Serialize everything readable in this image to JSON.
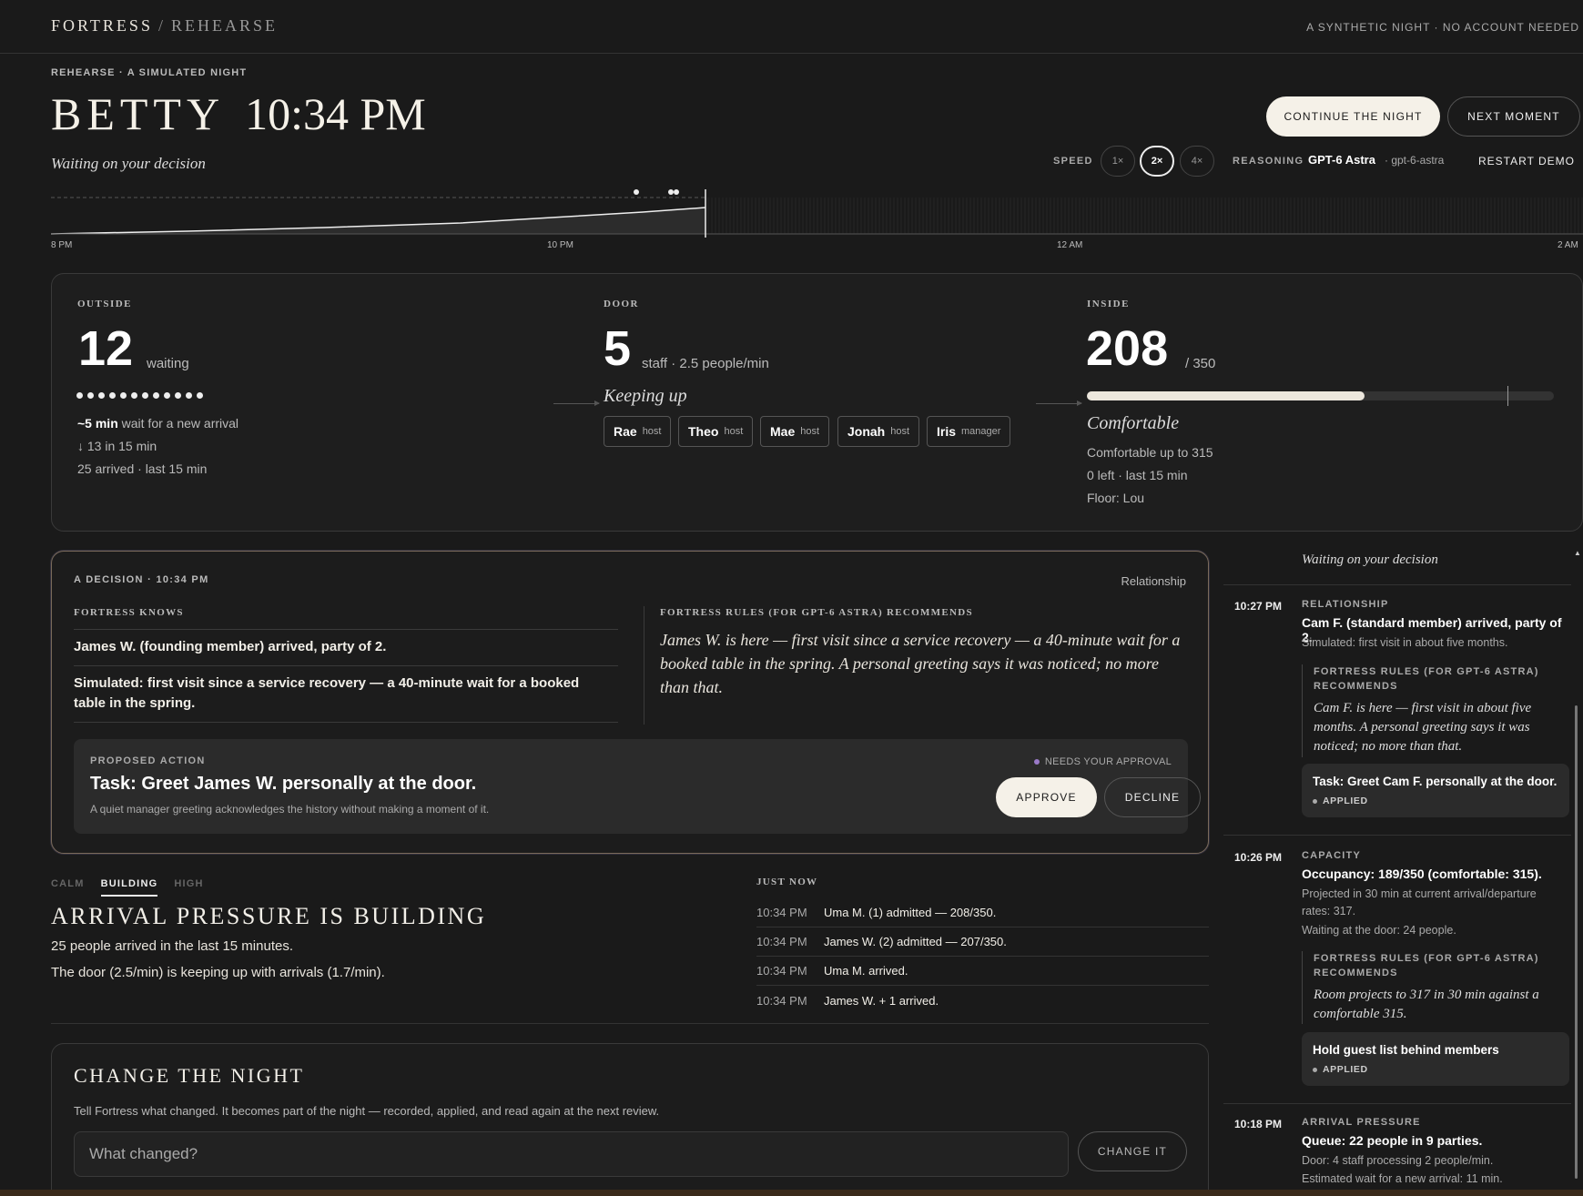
{
  "brand": {
    "name": "FORTRESS",
    "sep": "/",
    "section": "REHEARSE"
  },
  "top_right": "A SYNTHETIC NIGHT · NO ACCOUNT NEEDED",
  "eyebrow": "REHEARSE · A SIMULATED NIGHT",
  "hero": {
    "name": "BETTY",
    "time": "10:34 PM",
    "status": "Waiting on your decision"
  },
  "actions": {
    "continue": "CONTINUE THE NIGHT",
    "next": "NEXT MOMENT",
    "restart": "RESTART DEMO"
  },
  "speed": {
    "label": "SPEED",
    "options": [
      "1×",
      "2×",
      "4×"
    ],
    "selected": "2×"
  },
  "reasoning": {
    "label": "REASONING",
    "model_name": "GPT-6 Astra",
    "model_id": "· gpt-6-astra"
  },
  "timeline": {
    "ticks": [
      "8 PM",
      "10 PM",
      "12 AM",
      "2 AM"
    ],
    "progress": 0.425
  },
  "outside": {
    "label": "OUTSIDE",
    "count": "12",
    "unit": "waiting",
    "dot_count": 12,
    "wait_value": "~5 min",
    "wait_text": "wait for a new arrival",
    "trend": "↓ 13 in 15 min",
    "arrived": "25 arrived · last 15 min"
  },
  "door": {
    "label": "DOOR",
    "count": "5",
    "unit": "staff · 2.5 people/min",
    "status": "Keeping up",
    "staff": [
      {
        "name": "Rae",
        "role": "host"
      },
      {
        "name": "Theo",
        "role": "host"
      },
      {
        "name": "Mae",
        "role": "host"
      },
      {
        "name": "Jonah",
        "role": "host"
      },
      {
        "name": "Iris",
        "role": "manager"
      }
    ]
  },
  "inside": {
    "label": "INSIDE",
    "count": "208",
    "capacity": "/ 350",
    "fill_fraction": 0.594,
    "comfort_fraction": 0.9,
    "status": "Comfortable",
    "comfort_line": "Comfortable up to 315",
    "left_line": "0 left · last 15 min",
    "floor": "Floor: Lou"
  },
  "decision": {
    "eyebrow": "A DECISION · 10:34 PM",
    "tag": "Relationship",
    "knows_label": "FORTRESS KNOWS",
    "knows": [
      "James W. (founding member) arrived, party of 2.",
      "Simulated: first visit since a service recovery — a 40-minute wait for a booked table in the spring."
    ],
    "rec_label": "FORTRESS RULES (FOR GPT-6 ASTRA) RECOMMENDS",
    "rec_text": "James W. is here — first visit since a service recovery — a 40-minute wait for a booked table in the spring. A personal greeting says it was noticed; no more than that.",
    "proposal": {
      "label": "PROPOSED ACTION",
      "needs": "NEEDS YOUR APPROVAL",
      "title": "Task: Greet James W. personally at the door.",
      "desc": "A quiet manager greeting acknowledges the history without making a moment of it.",
      "approve": "APPROVE",
      "decline": "DECLINE"
    }
  },
  "pressure": {
    "tabs": [
      "CALM",
      "BUILDING",
      "HIGH"
    ],
    "active": "BUILDING",
    "heading": "ARRIVAL PRESSURE IS BUILDING",
    "lines": [
      "25 people arrived in the last 15 minutes.",
      "The door (2.5/min) is keeping up with arrivals (1.7/min)."
    ]
  },
  "just_now": {
    "label": "JUST NOW",
    "rows": [
      {
        "time": "10:34 PM",
        "text": "Uma M. (1) admitted — 208/350."
      },
      {
        "time": "10:34 PM",
        "text": "James W. (2) admitted — 207/350."
      },
      {
        "time": "10:34 PM",
        "text": "Uma M. arrived."
      },
      {
        "time": "10:34 PM",
        "text": "James W. + 1 arrived."
      }
    ]
  },
  "change": {
    "title": "CHANGE THE NIGHT",
    "desc": "Tell Fortress what changed. It becomes part of the night — recorded, applied, and read again at the next review.",
    "placeholder": "What changed?",
    "button": "CHANGE IT"
  },
  "log": {
    "head": "Waiting on your decision",
    "entries": [
      {
        "time": "10:27 PM",
        "category": "RELATIONSHIP",
        "title": "Cam F. (standard member) arrived, party of 2.",
        "subs": [
          "Simulated: first visit in about five months."
        ],
        "rec_label": "FORTRESS RULES (FOR GPT-6 ASTRA) RECOMMENDS",
        "rec_text": "Cam F. is here — first visit in about five months. A personal greeting says it was noticed; no more than that.",
        "applied_title": "Task: Greet Cam F. personally at the door.",
        "applied_status": "APPLIED"
      },
      {
        "time": "10:26 PM",
        "category": "CAPACITY",
        "title": "Occupancy: 189/350 (comfortable: 315).",
        "subs": [
          "Projected in 30 min at current arrival/departure rates: 317.",
          "Waiting at the door: 24 people."
        ],
        "rec_label": "FORTRESS RULES (FOR GPT-6 ASTRA) RECOMMENDS",
        "rec_text": "Room projects to 317 in 30 min against a comfortable 315.",
        "applied_title": "Hold guest list behind members",
        "applied_status": "APPLIED"
      },
      {
        "time": "10:18 PM",
        "category": "ARRIVAL PRESSURE",
        "title": "Queue: 22 people in 9 parties.",
        "subs": [
          "Door: 4 staff processing 2 people/min.",
          "Estimated wait for a new arrival: 11 min."
        ]
      }
    ]
  }
}
